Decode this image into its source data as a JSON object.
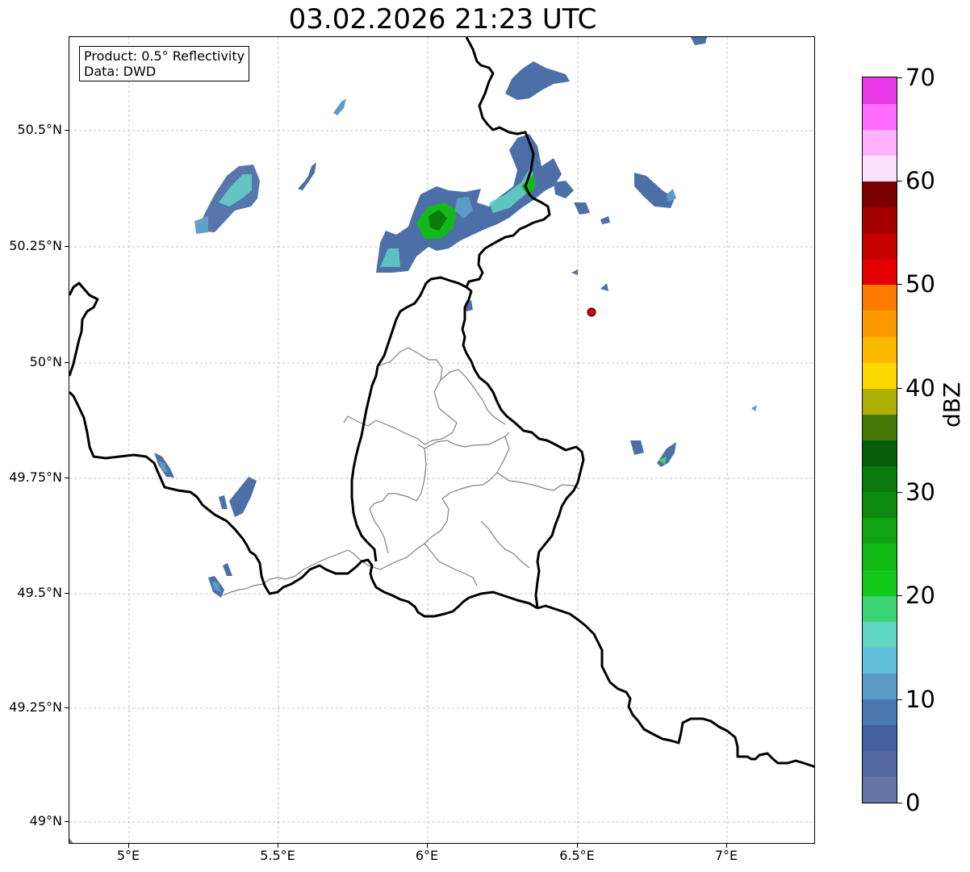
{
  "title": "03.02.2026 21:23 UTC",
  "info_box": {
    "product": "Product: 0.5° Reflectivity",
    "source": "Data: DWD"
  },
  "axes": {
    "lat_labels": [
      "50.5°N",
      "50.25°N",
      "50°N",
      "49.75°N",
      "49.5°N",
      "49.25°N",
      "49°N"
    ],
    "lat_values": [
      50.5,
      50.25,
      50.0,
      49.75,
      49.5,
      49.25,
      49.0
    ],
    "lon_labels": [
      "5°E",
      "5.5°E",
      "6°E",
      "6.5°E",
      "7°E"
    ],
    "lon_values": [
      5.0,
      5.5,
      6.0,
      6.5,
      7.0
    ],
    "lon_range": [
      4.8,
      7.3
    ],
    "lat_range": [
      48.95,
      50.7
    ],
    "grid": true
  },
  "colorbar": {
    "label": "dBZ",
    "min": 0,
    "max": 70,
    "tick_labels": [
      "0",
      "10",
      "20",
      "30",
      "40",
      "50",
      "60",
      "70"
    ],
    "tick_values": [
      0,
      10,
      20,
      30,
      40,
      50,
      60,
      70
    ],
    "colors": [
      "#6474a6",
      "#52689f",
      "#4360a0",
      "#4b79b0",
      "#5b9bc5",
      "#63c0dd",
      "#60d6c4",
      "#3dd574",
      "#14c81c",
      "#12b913",
      "#10a412",
      "#0d8a10",
      "#0a7a0c",
      "#085e08",
      "#447a09",
      "#aeb006",
      "#fdd800",
      "#fdb800",
      "#fd9a00",
      "#fd7a00",
      "#e30000",
      "#c50000",
      "#a50000",
      "#7b0000",
      "#ffe0ff",
      "#ffb1ff",
      "#ff6cff",
      "#e93ae9"
    ]
  },
  "station": {
    "name": "radar-site",
    "lon": 6.55,
    "lat": 50.11,
    "color": "#e00000"
  },
  "echo_colors": {
    "weak": "#4d6fa8",
    "light": "#5b9bc5",
    "cyan": "#60d6c4",
    "green": "#13b81a",
    "dark_green": "#0a7a0c"
  }
}
